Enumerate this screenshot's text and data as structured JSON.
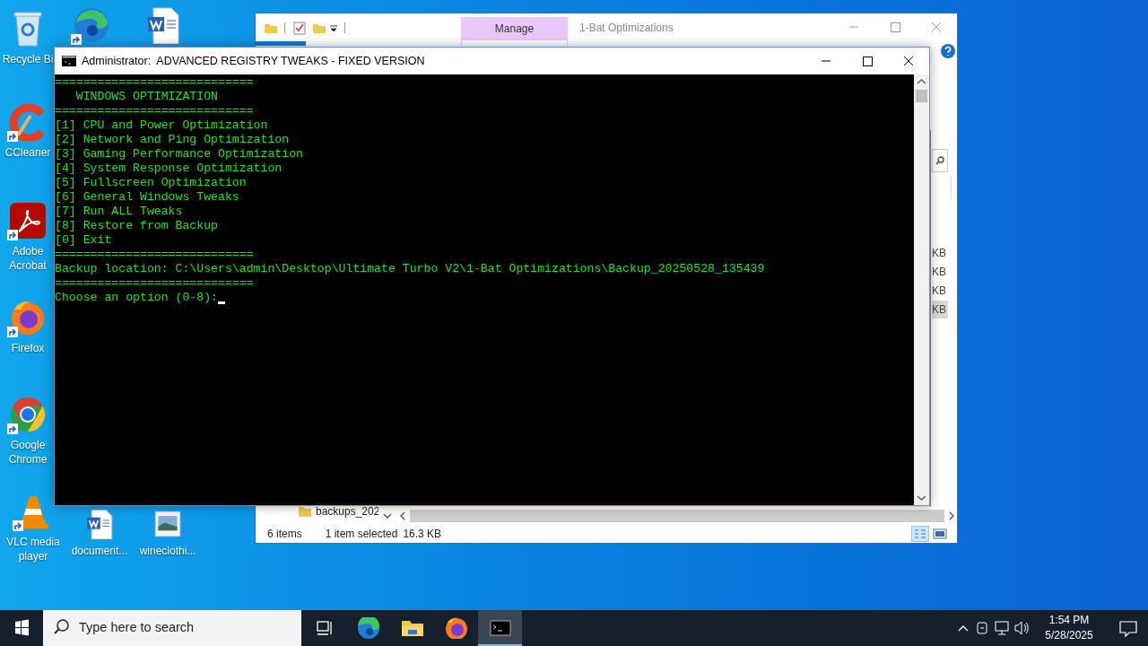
{
  "desktop": {
    "icons": [
      {
        "kind": "recycle-bin",
        "label": "Recycle Bi",
        "shortcut": false
      },
      {
        "kind": "edge",
        "shortcut": true
      },
      {
        "kind": "word-doc",
        "shortcut": false
      },
      {
        "kind": "ccleaner",
        "label": "CCleaner",
        "shortcut": true
      },
      {
        "kind": "acrobat",
        "label": "Adobe Acrobat",
        "shortcut": true
      },
      {
        "kind": "firefox",
        "label": "Firefox",
        "shortcut": true
      },
      {
        "kind": "chrome",
        "label": "Google Chrome",
        "shortcut": true
      },
      {
        "kind": "vlc",
        "label": "VLC media player",
        "shortcut": true
      },
      {
        "kind": "word-doc",
        "label": "document...",
        "shortcut": false
      },
      {
        "kind": "image",
        "label": "wineclothi...",
        "shortcut": false
      }
    ]
  },
  "explorer": {
    "title": "1-Bat Optimizations",
    "ribbon_tab": "Manage",
    "folder": "backups_202",
    "sizes": [
      {
        "text": "KB",
        "selected": false
      },
      {
        "text": "KB",
        "selected": false
      },
      {
        "text": "KB",
        "selected": false
      },
      {
        "text": "KB",
        "selected": true
      }
    ],
    "status": {
      "items": "6 items",
      "selection": "1 item selected",
      "size": "16.3 KB"
    }
  },
  "console": {
    "title": "Administrator:  ADVANCED REGISTRY TWEAKS - FIXED VERSION",
    "lines": [
      "============================",
      "   WINDOWS OPTIMIZATION",
      "============================",
      "[1] CPU and Power Optimization",
      "[2] Network and Ping Optimization",
      "[3] Gaming Performance Optimization",
      "[4] System Response Optimization",
      "[5] Fullscreen Optimization",
      "[6] General Windows Tweaks",
      "[7] Run ALL Tweaks",
      "[8] Restore from Backup",
      "[0] Exit",
      "============================",
      "Backup location: C:\\Users\\admin\\Desktop\\Ultimate Turbo V2\\1-Bat Optimizations\\Backup_20250528_135439",
      "============================"
    ],
    "prompt": "Choose an option (0-8): ",
    "cursor": true
  },
  "taskbar": {
    "search_placeholder": "Type here to search",
    "apps": [
      {
        "kind": "task-view",
        "active": false
      },
      {
        "kind": "edge",
        "active": false
      },
      {
        "kind": "file-explorer",
        "active": false
      },
      {
        "kind": "firefox",
        "active": false
      },
      {
        "kind": "terminal",
        "active": true
      }
    ],
    "time": "1:54 PM",
    "date": "5/28/2025"
  }
}
